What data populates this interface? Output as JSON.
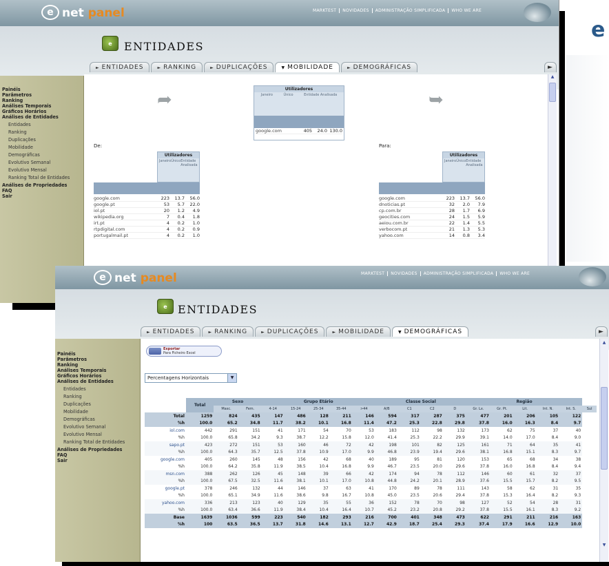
{
  "app": {
    "logo_main": "net",
    "logo_prefix": "e",
    "logo_suffix": "panel",
    "top_links": [
      "MARKTEST",
      "NOVIDADES",
      "ADMINISTRAÇÃO SIMPLIFICADA",
      "WHO WE ARE"
    ],
    "brand_partial": "e"
  },
  "header": {
    "title": "ENTIDADES"
  },
  "tabs_back": [
    {
      "label": "ENTIDADES"
    },
    {
      "label": "RANKING"
    },
    {
      "label": "DUPLICAÇÕES"
    },
    {
      "label": "MOBILIDADE",
      "active": true
    },
    {
      "label": "DEMOGRÁFICAS"
    }
  ],
  "tabs_front": [
    {
      "label": "ENTIDADES"
    },
    {
      "label": "RANKING"
    },
    {
      "label": "DUPLICAÇÕES"
    },
    {
      "label": "MOBILIDADE"
    },
    {
      "label": "DEMOGRÁFICAS",
      "active": true
    }
  ],
  "sidebar": {
    "items": [
      {
        "label": "Painéis",
        "kind": "item"
      },
      {
        "label": "Parâmetros",
        "kind": "item"
      },
      {
        "label": "Ranking",
        "kind": "item"
      },
      {
        "label": "Análises Temporais",
        "kind": "item"
      },
      {
        "label": "Gráficos Horários",
        "kind": "item"
      },
      {
        "label": "Análises de Entidades",
        "kind": "item"
      },
      {
        "label": "Entidades",
        "kind": "sub"
      },
      {
        "label": "Ranking",
        "kind": "sub"
      },
      {
        "label": "Duplicações",
        "kind": "sub"
      },
      {
        "label": "Mobilidade",
        "kind": "sub"
      },
      {
        "label": "Demográficas",
        "kind": "sub"
      },
      {
        "label": "Evolutivo Semanal",
        "kind": "sub"
      },
      {
        "label": "Evolutivo Mensal",
        "kind": "sub"
      },
      {
        "label": "Ranking Total de Entidades",
        "kind": "sub"
      },
      {
        "label": "Análises de Propriedades",
        "kind": "item"
      },
      {
        "label": "FAQ",
        "kind": "item"
      },
      {
        "label": "Sair",
        "kind": "item"
      }
    ]
  },
  "mobility": {
    "center": {
      "header": "Utilizadores",
      "cols": [
        "Janeiro",
        "Único",
        "Entidade Analisada"
      ],
      "row": {
        "name": "google.com",
        "v1": "405",
        "v2": "24.0",
        "v3": "130.0"
      }
    },
    "de_label": "De:",
    "para_label": "Para:",
    "table_header": "Utilizadores",
    "table_cols": [
      "Janeiro",
      "Único",
      "Entidade Analisada"
    ],
    "table_sub": [
      "(000)",
      "%",
      "%"
    ],
    "de_rows": [
      {
        "n": "google.com",
        "a": "223",
        "b": "13.7",
        "c": "56.0"
      },
      {
        "n": "google.pt",
        "a": "53",
        "b": "5.7",
        "c": "22.0"
      },
      {
        "n": "iol.pt",
        "a": "20",
        "b": "1.2",
        "c": "4.9"
      },
      {
        "n": "wikipedia.org",
        "a": "7",
        "b": "0.4",
        "c": "1.8"
      },
      {
        "n": "irt.pt",
        "a": "4",
        "b": "0.2",
        "c": "1.0"
      },
      {
        "n": "rtpdigital.com",
        "a": "4",
        "b": "0.2",
        "c": "0.9"
      },
      {
        "n": "portugalmail.pt",
        "a": "4",
        "b": "0.2",
        "c": "1.0"
      }
    ],
    "para_rows": [
      {
        "n": "google.com",
        "a": "223",
        "b": "13.7",
        "c": "56.0"
      },
      {
        "n": "dnoticias.pt",
        "a": "32",
        "b": "2.0",
        "c": "7.9"
      },
      {
        "n": "cp.com.br",
        "a": "28",
        "b": "1.7",
        "c": "6.9"
      },
      {
        "n": "geocities.com",
        "a": "24",
        "b": "1.5",
        "c": "5.9"
      },
      {
        "n": "aeiou.com.br",
        "a": "22",
        "b": "1.4",
        "c": "5.5"
      },
      {
        "n": "verbocom.pt",
        "a": "21",
        "b": "1.3",
        "c": "5.3"
      },
      {
        "n": "yahoo.com",
        "a": "14",
        "b": "0.8",
        "c": "3.4"
      }
    ]
  },
  "demographics": {
    "export_label": "Exportar",
    "export_sub": "Para Ficheiro Excel",
    "select_value": "Percentagens Horizontais",
    "groups": [
      "Total",
      "Sexo",
      "Grupo Etário",
      "Classe Social",
      "Região"
    ],
    "sub_headers": [
      "Masc.",
      "Fem.",
      "4-14",
      "15-24",
      "25-34",
      "35-44",
      ">44",
      "A/B",
      "C1",
      "C2",
      "D",
      "Gr. Lx.",
      "Gr. Pt.",
      "Lit.",
      "Int. N.",
      "Int. S.",
      "Sul"
    ],
    "rows": [
      {
        "label": "Total",
        "kind": "tot",
        "vals": [
          "1259",
          "824",
          "435",
          "147",
          "486",
          "128",
          "211",
          "146",
          "594",
          "317",
          "287",
          "375",
          "477",
          "201",
          "206",
          "105",
          "122"
        ]
      },
      {
        "label": "%h",
        "kind": "tot",
        "vals": [
          "100.0",
          "65.2",
          "34.8",
          "11.7",
          "38.2",
          "10.1",
          "16.8",
          "11.4",
          "47.2",
          "25.3",
          "22.8",
          "29.8",
          "37.8",
          "16.0",
          "16.3",
          "8.4",
          "9.7"
        ]
      },
      {
        "label": "iol.com",
        "kind": "ent",
        "vals": [
          "442",
          "291",
          "151",
          "41",
          "171",
          "54",
          "70",
          "53",
          "183",
          "112",
          "98",
          "132",
          "173",
          "62",
          "75",
          "37",
          "40"
        ]
      },
      {
        "label": "%h",
        "kind": "pct",
        "vals": [
          "100.0",
          "65.8",
          "34.2",
          "9.3",
          "38.7",
          "12.2",
          "15.8",
          "12.0",
          "41.4",
          "25.3",
          "22.2",
          "29.9",
          "39.1",
          "14.0",
          "17.0",
          "8.4",
          "9.0"
        ]
      },
      {
        "label": "sapo.pt",
        "kind": "ent",
        "vals": [
          "423",
          "272",
          "151",
          "53",
          "160",
          "46",
          "72",
          "42",
          "198",
          "101",
          "82",
          "125",
          "161",
          "71",
          "64",
          "35",
          "41"
        ]
      },
      {
        "label": "%h",
        "kind": "pct",
        "vals": [
          "100.0",
          "64.3",
          "35.7",
          "12.5",
          "37.8",
          "10.9",
          "17.0",
          "9.9",
          "46.8",
          "23.9",
          "19.4",
          "29.6",
          "38.1",
          "16.8",
          "15.1",
          "8.3",
          "9.7"
        ]
      },
      {
        "label": "google.com",
        "kind": "ent",
        "vals": [
          "405",
          "260",
          "145",
          "48",
          "156",
          "42",
          "68",
          "40",
          "189",
          "95",
          "81",
          "120",
          "153",
          "65",
          "68",
          "34",
          "38"
        ]
      },
      {
        "label": "%h",
        "kind": "pct",
        "vals": [
          "100.0",
          "64.2",
          "35.8",
          "11.9",
          "38.5",
          "10.4",
          "16.8",
          "9.9",
          "46.7",
          "23.5",
          "20.0",
          "29.6",
          "37.8",
          "16.0",
          "16.8",
          "8.4",
          "9.4"
        ]
      },
      {
        "label": "msn.com",
        "kind": "ent",
        "vals": [
          "388",
          "262",
          "126",
          "45",
          "148",
          "39",
          "66",
          "42",
          "174",
          "94",
          "78",
          "112",
          "146",
          "60",
          "61",
          "32",
          "37"
        ]
      },
      {
        "label": "%h",
        "kind": "pct",
        "vals": [
          "100.0",
          "67.5",
          "32.5",
          "11.6",
          "38.1",
          "10.1",
          "17.0",
          "10.8",
          "44.8",
          "24.2",
          "20.1",
          "28.9",
          "37.6",
          "15.5",
          "15.7",
          "8.2",
          "9.5"
        ]
      },
      {
        "label": "google.pt",
        "kind": "ent",
        "vals": [
          "378",
          "246",
          "132",
          "44",
          "146",
          "37",
          "63",
          "41",
          "170",
          "89",
          "78",
          "111",
          "143",
          "58",
          "62",
          "31",
          "35"
        ]
      },
      {
        "label": "%h",
        "kind": "pct",
        "vals": [
          "100.0",
          "65.1",
          "34.9",
          "11.6",
          "38.6",
          "9.8",
          "16.7",
          "10.8",
          "45.0",
          "23.5",
          "20.6",
          "29.4",
          "37.8",
          "15.3",
          "16.4",
          "8.2",
          "9.3"
        ]
      },
      {
        "label": "yahoo.com",
        "kind": "ent",
        "vals": [
          "336",
          "213",
          "123",
          "40",
          "129",
          "35",
          "55",
          "36",
          "152",
          "78",
          "70",
          "98",
          "127",
          "52",
          "54",
          "28",
          "31"
        ]
      },
      {
        "label": "%h",
        "kind": "pct",
        "vals": [
          "100.0",
          "63.4",
          "36.6",
          "11.9",
          "38.4",
          "10.4",
          "16.4",
          "10.7",
          "45.2",
          "23.2",
          "20.8",
          "29.2",
          "37.8",
          "15.5",
          "16.1",
          "8.3",
          "9.2"
        ]
      },
      {
        "label": "Base",
        "kind": "tot",
        "vals": [
          "1639",
          "1036",
          "599",
          "223",
          "540",
          "182",
          "293",
          "216",
          "700",
          "401",
          "348",
          "473",
          "622",
          "291",
          "211",
          "216",
          "163"
        ]
      },
      {
        "label": "%h",
        "kind": "tot",
        "vals": [
          "100",
          "63.5",
          "36.5",
          "13.7",
          "31.8",
          "14.6",
          "13.1",
          "12.7",
          "42.9",
          "18.7",
          "25.4",
          "29.3",
          "37.4",
          "17.9",
          "16.6",
          "12.9",
          "10.0"
        ]
      }
    ]
  }
}
